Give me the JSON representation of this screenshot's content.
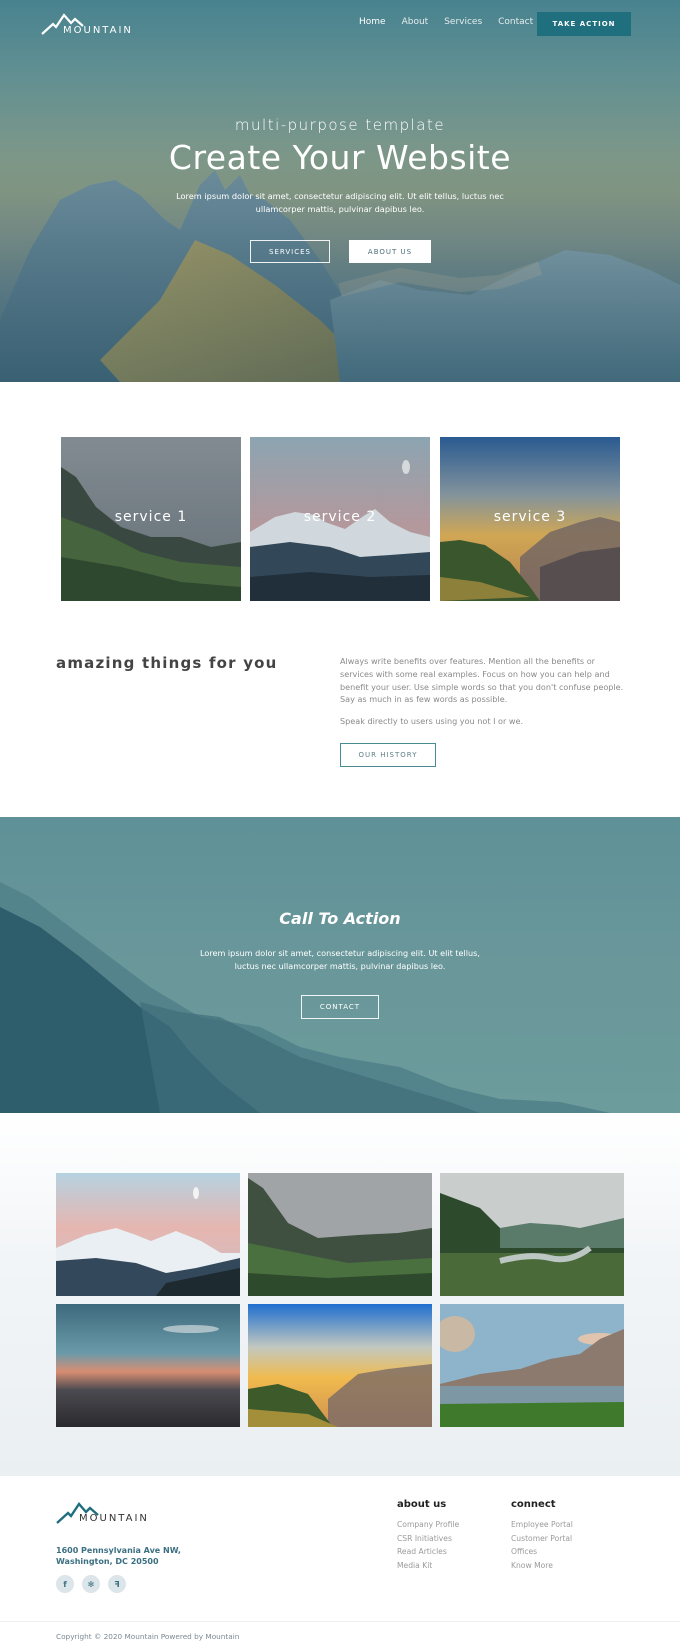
{
  "nav": {
    "logo_text": "MOUNTAIN",
    "links": [
      "Home",
      "About",
      "Services",
      "Contact"
    ],
    "active_link": "Home",
    "cta_label": "TAKE ACTION"
  },
  "hero": {
    "subtitle": "multi-purpose template",
    "title": "Create Your Website",
    "text": "Lorem ipsum dolor sit amet, consectetur adipiscing elit. Ut elit tellus, luctus nec ullamcorper mattis, pulvinar dapibus leo.",
    "buttons": [
      "SERVICES",
      "ABOUT US"
    ]
  },
  "services": [
    {
      "label": "service 1",
      "image": "misty-forest-mountain"
    },
    {
      "label": "service 2",
      "image": "snowy-peak-moon"
    },
    {
      "label": "service 3",
      "image": "sunrise-hikers"
    }
  ],
  "about": {
    "heading": "amazing things for you",
    "paragraph1": "Always write benefits over features. Mention all the benefits or services with some real examples. Focus on how you can help and benefit your user. Use simple words so that you don't confuse people. Say as much in as few words as possible.",
    "paragraph2": "Speak directly to users using you not I or we.",
    "button": "OUR HISTORY"
  },
  "cta": {
    "title": "Call To Action",
    "text": "Lorem ipsum dolor sit amet, consectetur adipiscing elit. Ut elit tellus, luctus nec ullamcorper mattis, pulvinar dapibus leo.",
    "button": "CONTACT"
  },
  "gallery": [
    "snowy-peak-moon",
    "misty-forest-mountain",
    "river-valley",
    "sunset-above-clouds",
    "sunrise-hikers",
    "lake-mountains"
  ],
  "footer": {
    "logo_text": "MOUNTAIN",
    "address_line1": "1600 Pennsylvania Ave NW,",
    "address_line2": "Washington, DC 20500",
    "social": [
      {
        "name": "facebook-icon",
        "glyph": "f"
      },
      {
        "name": "yelp-icon",
        "glyph": "✻"
      },
      {
        "name": "foursquare-icon",
        "glyph": "ꟻ"
      }
    ],
    "columns": [
      {
        "title": "about us",
        "links": [
          "Company Profile",
          "CSR Initiatives",
          "Read Articles",
          "Media Kit"
        ]
      },
      {
        "title": "connect",
        "links": [
          "Employee Portal",
          "Customer Portal",
          "Offices",
          "Know More"
        ]
      }
    ],
    "copyright": "Copyright © 2020 Mountain Powered by Mountain"
  },
  "colors": {
    "brand": "#1f6f7e",
    "accent_text": "#3b6f82",
    "outline_button": "#4a8a92"
  }
}
